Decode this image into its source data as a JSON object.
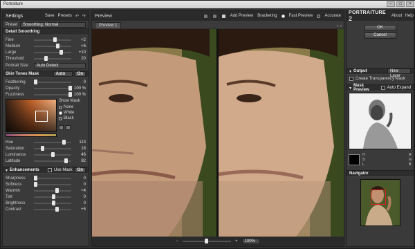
{
  "app": {
    "title": "Portraiture"
  },
  "left": {
    "tabs": {
      "settings": "Settings",
      "save": "Save",
      "presets": "Presets",
      "undo": "↶",
      "redo": "↷"
    },
    "preset": {
      "label": "Preset",
      "value": "Smoothing: Normal"
    },
    "detail": {
      "title": "Detail Smoothing",
      "sliders": [
        {
          "label": "Fine",
          "value": "+2"
        },
        {
          "label": "Medium",
          "value": "+6"
        },
        {
          "label": "Large",
          "value": "+10"
        },
        {
          "label": "Threshold",
          "value": "20"
        }
      ],
      "portrait_size": {
        "label": "Portrait Size",
        "value": "Auto Detect"
      }
    },
    "skin": {
      "title": "Skin Tones Mask",
      "mode": "Auto",
      "toggle": "On",
      "sliders": [
        {
          "label": "Feathering",
          "value": "0"
        },
        {
          "label": "Opacity",
          "value": "100 %"
        },
        {
          "label": "Fuzziness",
          "value": "100 %"
        }
      ],
      "show_mask": {
        "label": "Show Mask",
        "options": [
          "None",
          "White",
          "Black"
        ]
      },
      "hsl": [
        {
          "label": "Hue",
          "value": "113"
        },
        {
          "label": "Saturation",
          "value": "18"
        },
        {
          "label": "Luminance",
          "value": "46"
        },
        {
          "label": "Latitude",
          "value": "82"
        }
      ]
    },
    "enh": {
      "title": "Enhancements",
      "use_mask": "Use Mask",
      "toggle": "On",
      "sliders": [
        {
          "label": "Sharpness",
          "value": "0"
        },
        {
          "label": "Softness",
          "value": "0"
        },
        {
          "label": "Warmth",
          "value": "+4"
        },
        {
          "label": "Tint",
          "value": "0"
        },
        {
          "label": "Brightness",
          "value": "0"
        },
        {
          "label": "Contrast",
          "value": "+5"
        }
      ]
    }
  },
  "center": {
    "preview_label": "Preview",
    "add_preview": "Add Preview",
    "bracketing": "Bracketing",
    "fast_preview": "Fast Preview",
    "accurate": "Accurate",
    "tab": "Preview 1",
    "zoom": "100%"
  },
  "right": {
    "logo": "PORTRAITURE",
    "version": "2",
    "about": "About",
    "help": "Help",
    "ok": "OK",
    "cancel": "Cancel",
    "output": {
      "title": "Output",
      "value": "New Layer",
      "transparency": "Create Transparency Mask"
    },
    "mask_preview": {
      "title": "Mask Preview",
      "auto_expand": "Auto Expand",
      "labels": [
        "H",
        "S",
        "L",
        "R",
        "G",
        "B"
      ]
    },
    "navigator": {
      "title": "Navigator"
    }
  },
  "colors": {
    "panel": "#3a3a3a",
    "accent": "#d62b2b",
    "bg": "#2b2b2b"
  }
}
